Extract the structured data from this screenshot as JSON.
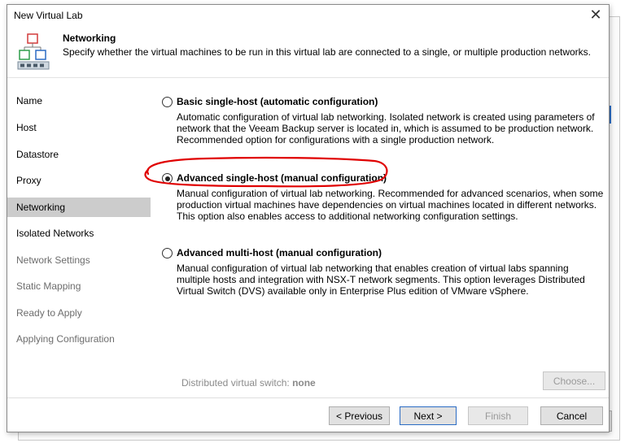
{
  "window": {
    "title": "New Virtual Lab",
    "close_icon": "close-icon",
    "header_icon": "virtual-lab-network-icon"
  },
  "header": {
    "title": "Networking",
    "subtitle": "Specify whether the virtual machines to be run in this virtual lab are connected to a single, or multiple production networks."
  },
  "sidebar": {
    "items": [
      {
        "label": "Name",
        "state": "done"
      },
      {
        "label": "Host",
        "state": "done"
      },
      {
        "label": "Datastore",
        "state": "done"
      },
      {
        "label": "Proxy",
        "state": "done"
      },
      {
        "label": "Networking",
        "state": "active"
      },
      {
        "label": "Isolated Networks",
        "state": "enabled"
      },
      {
        "label": "Network Settings",
        "state": "disabled"
      },
      {
        "label": "Static Mapping",
        "state": "disabled"
      },
      {
        "label": "Ready to Apply",
        "state": "disabled"
      },
      {
        "label": "Applying Configuration",
        "state": "disabled"
      }
    ]
  },
  "options": [
    {
      "label": "Basic single-host (automatic configuration)",
      "selected": false,
      "description": "Automatic configuration of virtual lab networking. Isolated network is created using parameters of network that the Veeam Backup server is located in, which is assumed to be production network. Recommended option for configurations with a single production network."
    },
    {
      "label": "Advanced single-host (manual configuration)",
      "selected": true,
      "description": "Manual configuration of virtual lab networking. Recommended for advanced scenarios, when some production virtual machines have dependencies on virtual machines located in different networks. This option also enables access to additional networking configuration settings."
    },
    {
      "label": "Advanced multi-host (manual configuration)",
      "selected": false,
      "description": "Manual configuration of virtual lab networking that enables creation of virtual labs spanning multiple hosts and integration with NSX-T network segments. This option leverages Distributed Virtual Switch (DVS) available only in Enterprise Plus edition of VMware vSphere."
    }
  ],
  "dvs": {
    "label": "Distributed virtual switch:",
    "value": "none",
    "choose_label": "Choose..."
  },
  "footer": {
    "previous_label": "< Previous",
    "next_label": "Next >",
    "finish_label": "Finish",
    "cancel_label": "Cancel"
  },
  "colors": {
    "active_nav_bg": "#cccccc",
    "highlight_circle": "#e00000",
    "accent_border": "#2b6cc4"
  }
}
